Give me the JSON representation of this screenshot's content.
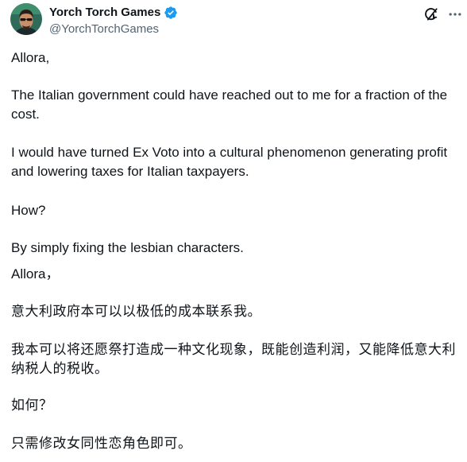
{
  "author": {
    "display_name": "Yorch Torch Games",
    "handle": "@YorchTorchGames",
    "verified": true,
    "avatar_icon": "avatar-portrait-icon",
    "verified_color": "#1d9bf0"
  },
  "actions": {
    "grok_icon": "grok-icon",
    "more_icon": "more-horizontal-icon"
  },
  "tweet": {
    "paragraphs": [
      "Allora,",
      "The Italian government could have reached out to me for a fraction of the cost.",
      "I would have turned Ex Voto into a cultural phenomenon generating profit and lowering taxes for Italian taxpayers.",
      "How?",
      "By simply fixing the lesbian characters.",
      "Allora，",
      "意大利政府本可以以极低的成本联系我。",
      "我本可以将还愿祭打造成一种文化现象，既能创造利润，又能降低意大利纳税人的税收。",
      "如何？",
      "只需修改女同性恋角色即可。"
    ]
  },
  "colors": {
    "text_primary": "#0f1419",
    "text_secondary": "#536471",
    "background": "#ffffff"
  }
}
